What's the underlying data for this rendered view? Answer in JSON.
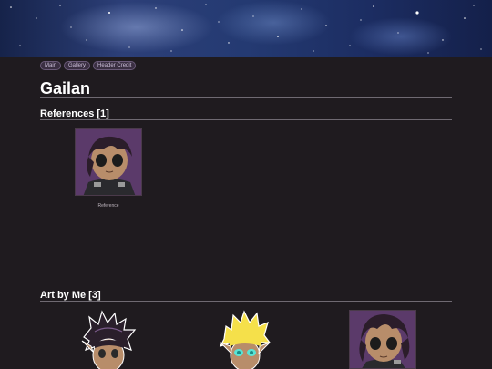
{
  "nav": {
    "items": [
      "Main",
      "Gallery",
      "Header Credit"
    ]
  },
  "page": {
    "title": "Gailan"
  },
  "references": {
    "heading": "References [1]",
    "items": [
      {
        "caption": "Reference"
      }
    ]
  },
  "art_by_me": {
    "heading": "Art by Me [3]"
  },
  "colors": {
    "background": "#1f1b1f",
    "accent": "#6a5a78",
    "text": "#ffffff"
  }
}
